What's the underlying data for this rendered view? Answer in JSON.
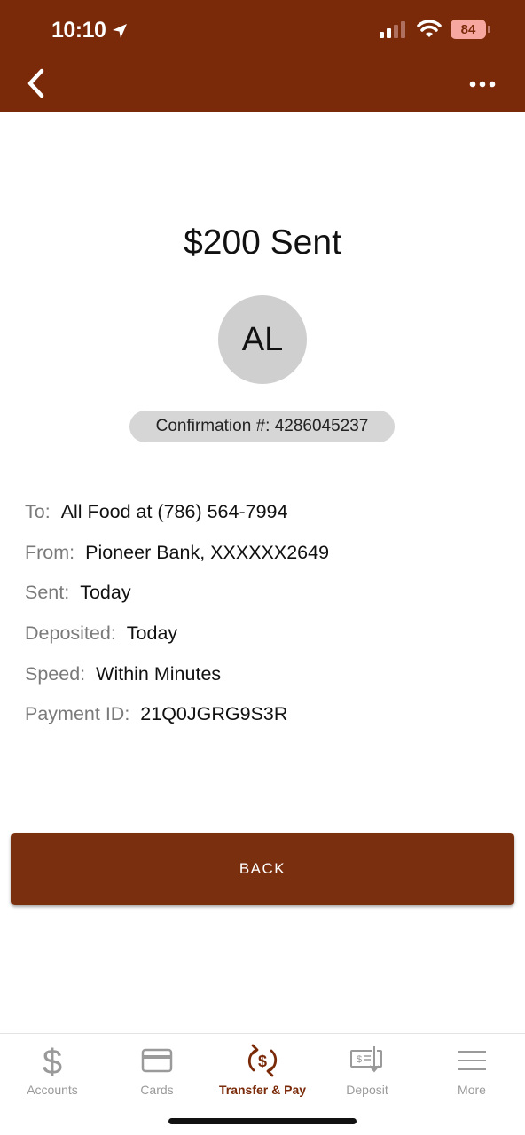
{
  "status_bar": {
    "time": "10:10",
    "battery": "84"
  },
  "header": {
    "back_icon": "chevron-left-icon",
    "more_icon": "more-dots-icon"
  },
  "transfer": {
    "title": "$200 Sent",
    "avatar_initials": "AL",
    "confirmation": "Confirmation #: 4286045237",
    "details": [
      {
        "label": "To:",
        "value": "All Food at (786) 564-7994"
      },
      {
        "label": "From:",
        "value": "Pioneer Bank, XXXXXX2649"
      },
      {
        "label": "Sent:",
        "value": "Today"
      },
      {
        "label": "Deposited:",
        "value": "Today"
      },
      {
        "label": "Speed:",
        "value": "Within Minutes"
      },
      {
        "label": "Payment ID:",
        "value": "21Q0JGRG9S3R"
      }
    ]
  },
  "back_button": {
    "label": "BACK"
  },
  "tab_bar": {
    "tabs": [
      {
        "label": "Accounts",
        "icon": "dollar-icon"
      },
      {
        "label": "Cards",
        "icon": "card-icon"
      },
      {
        "label": "Transfer & Pay",
        "icon": "transfer-pay-icon"
      },
      {
        "label": "Deposit",
        "icon": "check-deposit-icon"
      },
      {
        "label": "More",
        "icon": "menu-icon"
      }
    ],
    "active_index": 2
  },
  "colors": {
    "brand": "#7a2a08",
    "inactive_tab": "#9a9a9a"
  }
}
